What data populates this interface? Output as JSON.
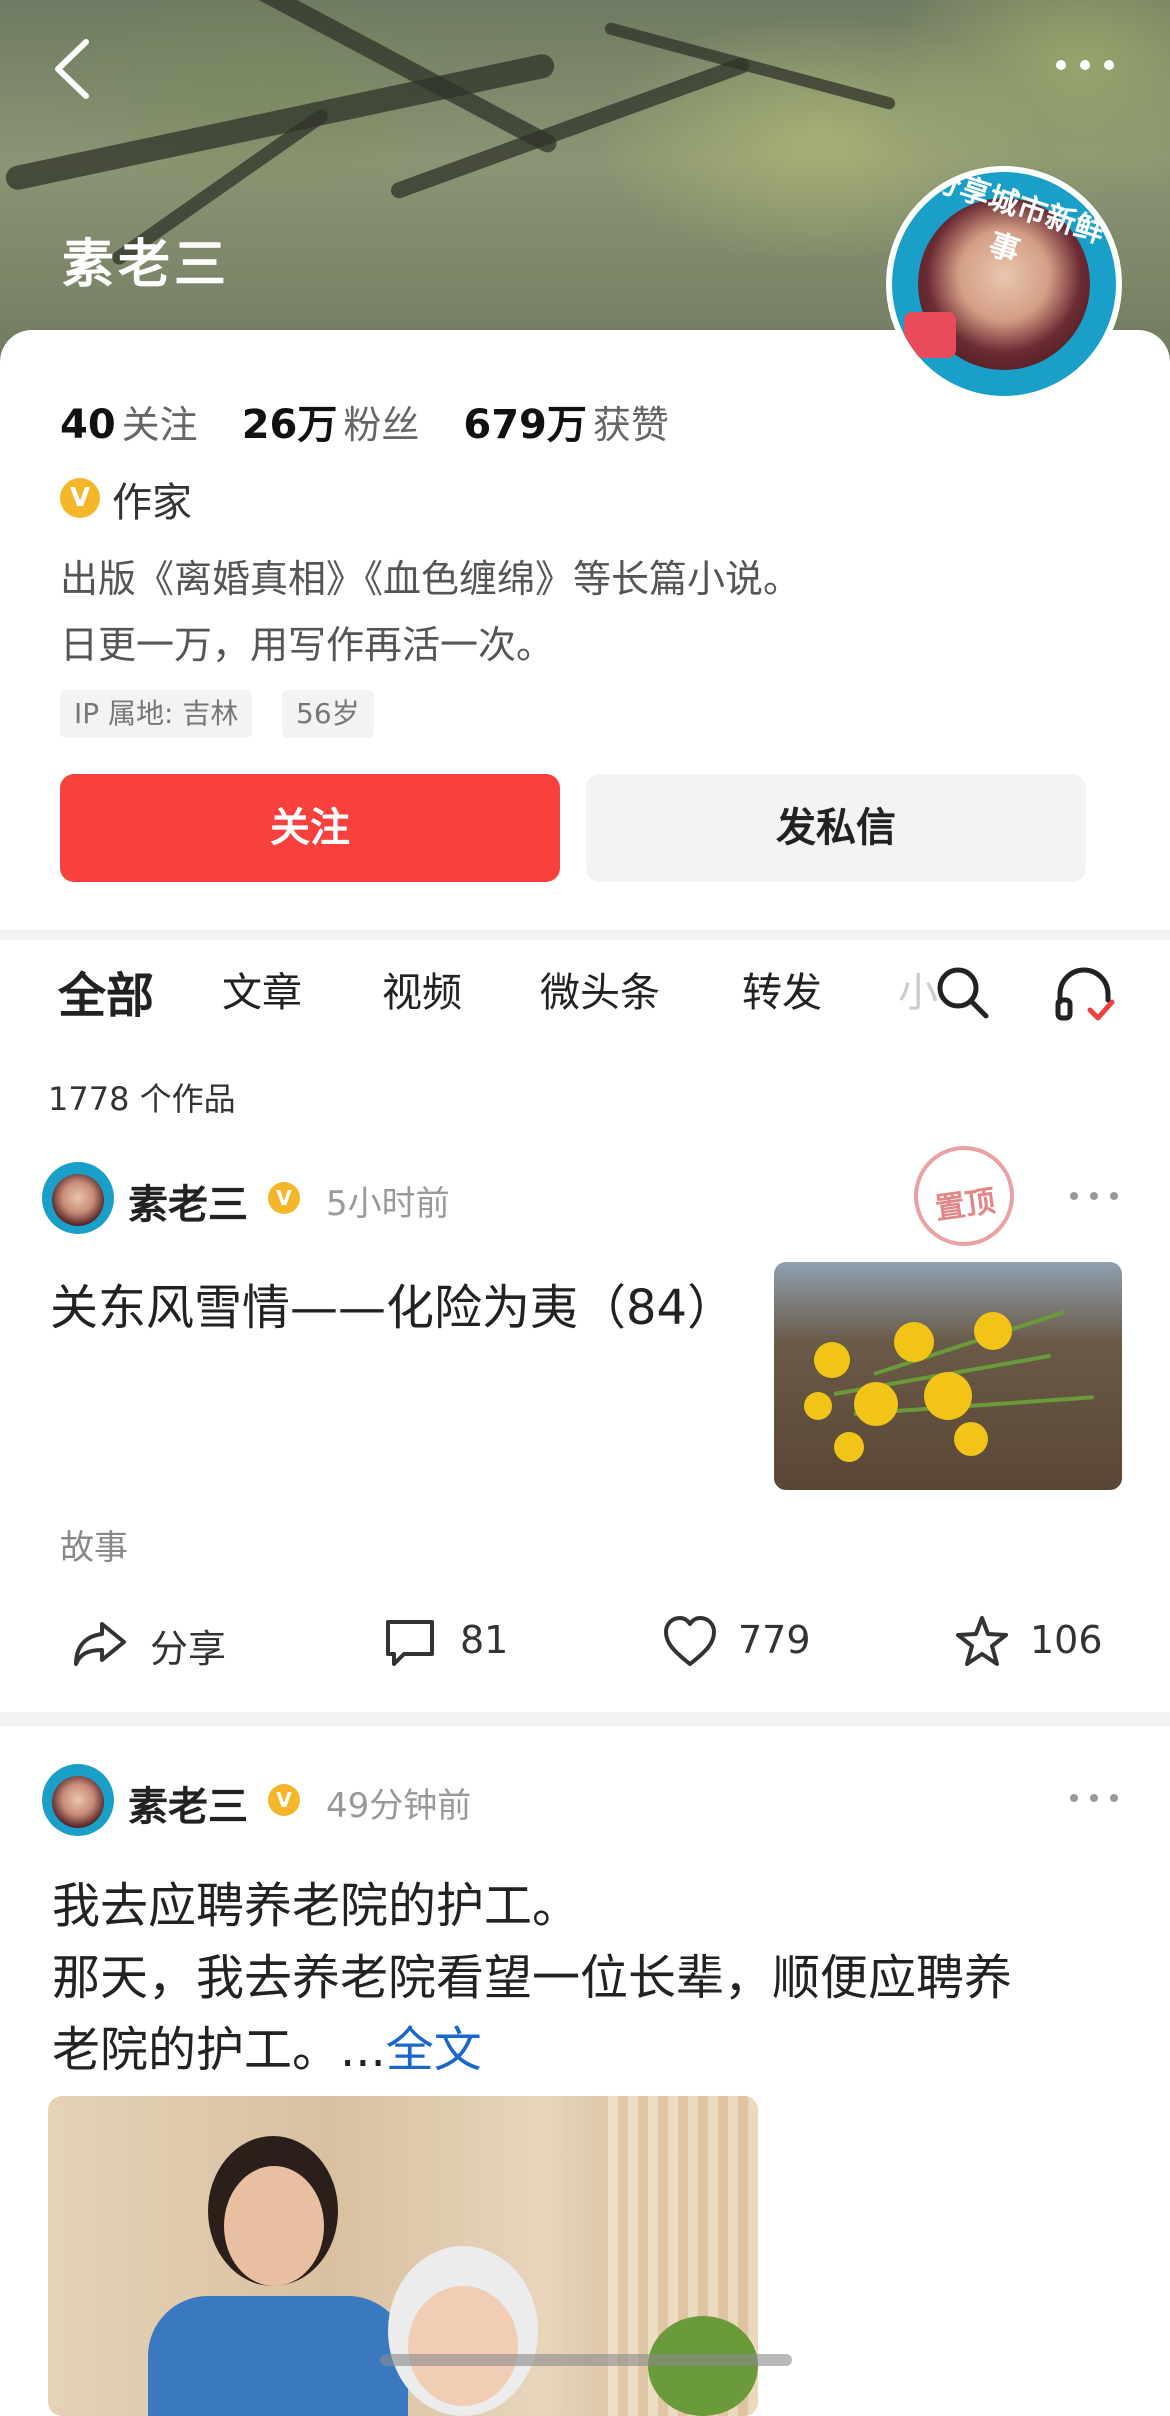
{
  "header": {
    "username": "素老三"
  },
  "avatar_badge": "分享城市新鲜事",
  "profile": {
    "stats": [
      {
        "value": "40",
        "label": "关注"
      },
      {
        "value": "26万",
        "label": "粉丝"
      },
      {
        "value": "679万",
        "label": "获赞"
      }
    ],
    "verified_badge": "V",
    "role": "作家",
    "bio_line1": "出版《离婚真相》《血色缠绵》等长篇小说。",
    "bio_line2": "日更一万，用写作再活一次。",
    "tags": [
      "IP 属地: 吉林",
      "56岁"
    ],
    "follow_label": "关注",
    "message_label": "发私信"
  },
  "tabs": [
    "全部",
    "文章",
    "视频",
    "微头条",
    "转发",
    "小"
  ],
  "works_count": "1778 个作品",
  "posts": [
    {
      "author": "素老三",
      "verified": "V",
      "time": "5小时前",
      "pinned_label": "置顶",
      "title": "关东风雪情——化险为夷（84）",
      "category": "故事",
      "share_label": "分享",
      "comments": "81",
      "likes": "779",
      "favorites": "106"
    },
    {
      "author": "素老三",
      "verified": "V",
      "time": "49分钟前",
      "line1": "我去应聘养老院的护工。",
      "line2": "那天，我去养老院看望一位长辈，顺便应聘养",
      "line3": "老院的护工。...",
      "fulltext_link": "全文"
    }
  ]
}
